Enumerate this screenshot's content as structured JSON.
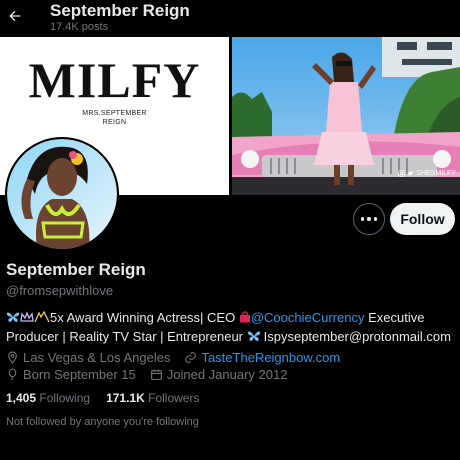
{
  "header": {
    "title": "September Reign",
    "posts": "17.4K posts"
  },
  "banner": {
    "brand": "MILFY",
    "brand_sub_line1": "MRS.SEPTEMBER",
    "brand_sub_line2": "REIGN",
    "watermark": "SHESMILFY"
  },
  "actions": {
    "follow_label": "Follow"
  },
  "profile": {
    "name": "September Reign",
    "handle": "@fromsepwithlove",
    "bio_part1": "5x Award Winning Actress| CEO ",
    "bio_mention": "@CoochieCurrency",
    "bio_part2": " Executive Producer | Reality TV Star | Entrepreneur ",
    "bio_email": "Ispyseptember@protonmail.com",
    "location": "Las Vegas & Los Angeles",
    "website": "TasteTheReignbow.com",
    "birthday": "Born September 15",
    "joined": "Joined January 2012",
    "following_count": "1,405",
    "following_label": "Following",
    "followers_count": "171.1K",
    "followers_label": "Followers",
    "followed_note": "Not followed by anyone you're following"
  },
  "icons": {
    "back": "arrow-left-icon",
    "more": "ellipsis-icon",
    "location": "location-pin-icon",
    "link": "link-icon",
    "birthday": "balloon-icon",
    "calendar": "calendar-icon"
  },
  "colors": {
    "background": "#000000",
    "text": "#e7e9ea",
    "secondary": "#71767b",
    "link": "#1d9bf0",
    "follow_bg": "#eff3f4"
  }
}
